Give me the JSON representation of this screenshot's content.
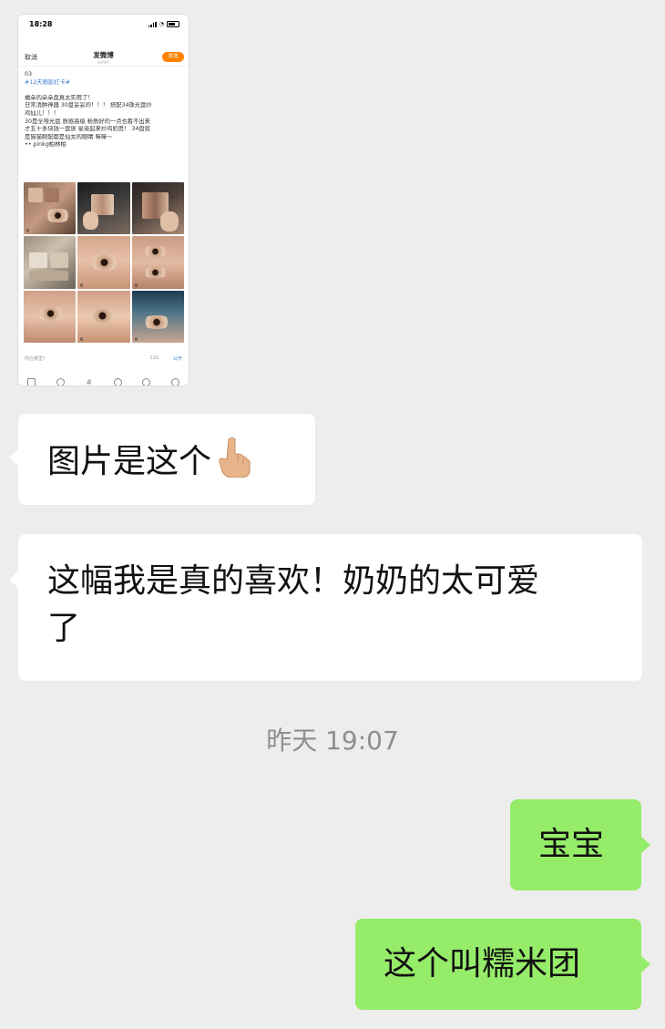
{
  "shared_screenshot": {
    "status_time": "18:28",
    "nav": {
      "cancel": "取消",
      "title": "发微博",
      "subtitle": "pinkt",
      "send": "发送"
    },
    "post_lines": [
      "03",
      "#12天眼影打卡#",
      "",
      "橘朵的朵朵盘真太实用了！",
      "日常消肿神器 30盘妥妥的！！！ 搭配34珠光盘炒",
      "鸡仙儿！！！",
      "30是全哑光盘 质感高级 粉质好的一点也看不出来",
      "才五十多块钱一盘诶 晕染起来炒鸡奶思！ 34盘就",
      "是猫猫眼配都是仙女的眼睛 嘛嘛～",
      "•• pinkg柏林柏"
    ],
    "meta": {
      "question": "你在哪里?",
      "count": "110",
      "visibility": "公开"
    }
  },
  "messages": [
    {
      "side": "left",
      "text": "图片是这个"
    },
    {
      "side": "left",
      "text_line1": "这幅我是真的喜欢！奶奶的太可爱",
      "text_line2": "了"
    },
    {
      "side": "right",
      "text": "宝宝"
    },
    {
      "side": "right",
      "text": "这个叫糯米团"
    }
  ],
  "timestamp": "昨天 19:07",
  "colors": {
    "background": "#ededed",
    "bubble_left": "#ffffff",
    "bubble_right": "#95ec69",
    "weibo_orange": "#ff8200",
    "weibo_blue": "#3c7fc9"
  }
}
